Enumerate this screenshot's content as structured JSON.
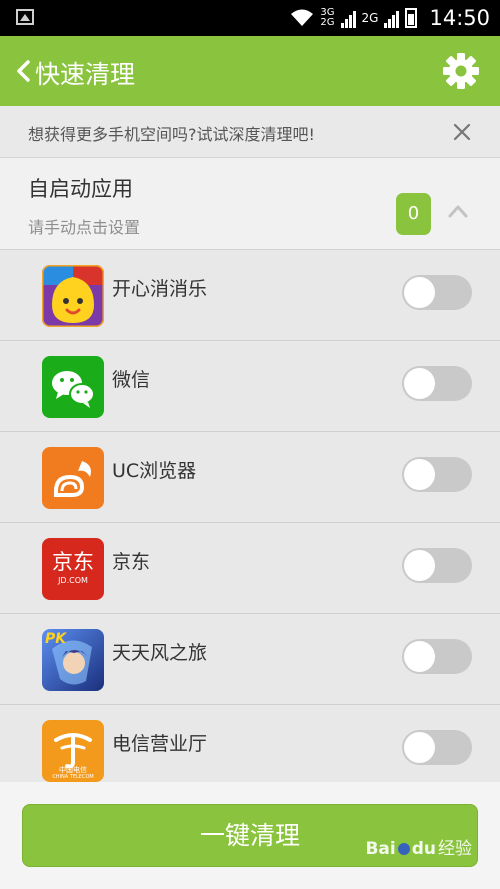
{
  "status_bar": {
    "net1_top": "3G",
    "net1_bottom": "2G",
    "net2": "2G",
    "time": "14:50"
  },
  "header": {
    "title": "快速清理",
    "back_icon": "chevron-left-icon",
    "settings_icon": "gear-icon"
  },
  "banner": {
    "text": "想获得更多手机空间吗?试试深度清理吧!",
    "close_icon": "close-icon"
  },
  "section": {
    "title": "自启动应用",
    "subtitle": "请手动点击设置",
    "count": "0",
    "collapse_icon": "chevron-up-icon"
  },
  "apps": [
    {
      "name": "开心消消乐",
      "icon": "happy-elimination-icon",
      "enabled": false,
      "icon_color": "#f5a52a"
    },
    {
      "name": "微信",
      "icon": "wechat-icon",
      "enabled": false,
      "icon_color": "#1aad19"
    },
    {
      "name": "UC浏览器",
      "icon": "uc-browser-icon",
      "enabled": false,
      "icon_color": "#f07c1f"
    },
    {
      "name": "京东",
      "icon": "jd-icon",
      "enabled": false,
      "icon_color": "#d7281e",
      "icon_text": "京东",
      "icon_subtext": "JD.COM"
    },
    {
      "name": "天天风之旅",
      "icon": "game-icon",
      "enabled": false,
      "icon_color": "#2b57b7",
      "icon_text": "PK"
    },
    {
      "name": "电信营业厅",
      "icon": "china-telecom-icon",
      "enabled": false,
      "icon_color": "#f39a1c",
      "icon_text": "中国电信",
      "icon_subtext": "CHINA TELECOM"
    }
  ],
  "footer": {
    "button_label": "一键清理",
    "watermark_left": "Bai",
    "watermark_mid": "du",
    "watermark_right": "经验"
  },
  "colors": {
    "accent": "#8ac43e",
    "toggle_off": "#c9c9c9"
  }
}
